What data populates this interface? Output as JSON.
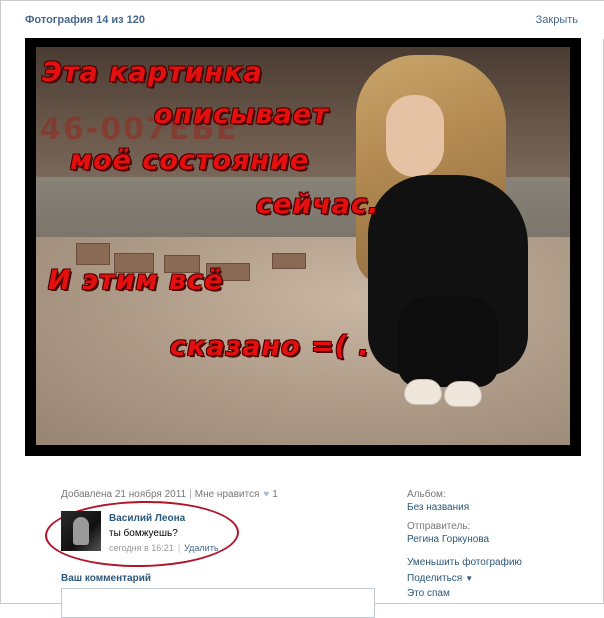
{
  "header": {
    "photo_counter": "Фотография 14 из 120",
    "close_label": "Закрыть"
  },
  "photo": {
    "graffiti": "46-007ЕБЕ",
    "caption_lines": [
      "Эта картинка",
      "описывает",
      "моё состояние",
      "сейчас.",
      "И этим всё",
      "сказано =( ."
    ]
  },
  "meta": {
    "added": "Добавлена 21 ноября 2011",
    "like_label": "Мне нравится",
    "like_count": "1"
  },
  "comment": {
    "author": "Василий Леона",
    "text": "ты бомжуешь?",
    "time": "сегодня в 16:21",
    "delete_label": "Удалить"
  },
  "composer": {
    "label": "Ваш комментарий"
  },
  "sidebar": {
    "album_label": "Альбом:",
    "album_value": "Без названия",
    "sender_label": "Отправитель:",
    "sender_value": "Регина Горкунова",
    "actions": {
      "shrink": "Уменьшить фотографию",
      "share": "Поделиться",
      "spam": "Это спам"
    }
  },
  "colors": {
    "link": "#2b587a",
    "caption_red": "#e41010",
    "highlight_ellipse": "#b0162a"
  }
}
